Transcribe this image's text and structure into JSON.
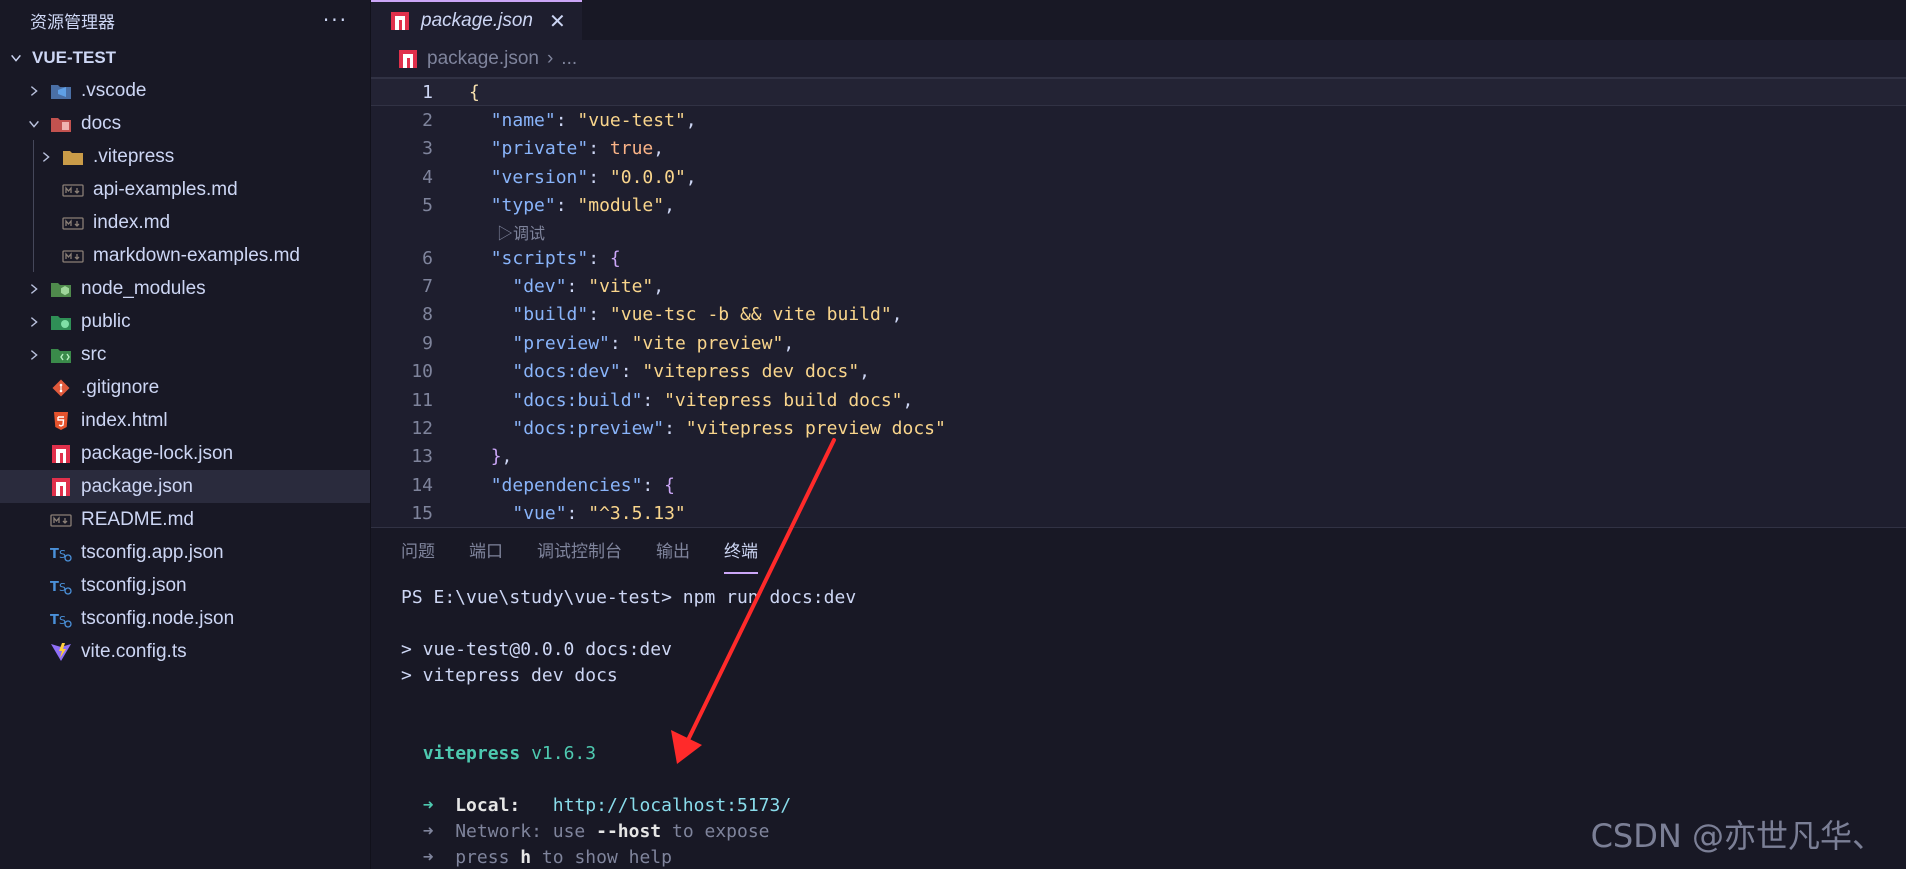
{
  "sidebar": {
    "title": "资源管理器",
    "more_label": "···",
    "project": "VUE-TEST",
    "items": [
      {
        "label": ".vscode",
        "icon": "vscode-folder-icon",
        "chevron": "right",
        "depth": 0
      },
      {
        "label": "docs",
        "icon": "docs-folder-icon",
        "chevron": "down",
        "depth": 0
      },
      {
        "label": ".vitepress",
        "icon": "folder-icon",
        "chevron": "right",
        "depth": 1
      },
      {
        "label": "api-examples.md",
        "icon": "markdown-icon",
        "chevron": "none",
        "depth": 1
      },
      {
        "label": "index.md",
        "icon": "markdown-icon",
        "chevron": "none",
        "depth": 1
      },
      {
        "label": "markdown-examples.md",
        "icon": "markdown-icon",
        "chevron": "none",
        "depth": 1
      },
      {
        "label": "node_modules",
        "icon": "node-folder-icon",
        "chevron": "right",
        "depth": 0
      },
      {
        "label": "public",
        "icon": "public-folder-icon",
        "chevron": "right",
        "depth": 0
      },
      {
        "label": "src",
        "icon": "src-folder-icon",
        "chevron": "right",
        "depth": 0
      },
      {
        "label": ".gitignore",
        "icon": "git-icon",
        "chevron": "none",
        "depth": 0
      },
      {
        "label": "index.html",
        "icon": "html5-icon",
        "chevron": "none",
        "depth": 0
      },
      {
        "label": "package-lock.json",
        "icon": "npm-icon",
        "chevron": "none",
        "depth": 0
      },
      {
        "label": "package.json",
        "icon": "npm-icon",
        "chevron": "none",
        "depth": 0,
        "selected": true
      },
      {
        "label": "README.md",
        "icon": "markdown-icon",
        "chevron": "none",
        "depth": 0
      },
      {
        "label": "tsconfig.app.json",
        "icon": "tsconfig-icon",
        "chevron": "none",
        "depth": 0
      },
      {
        "label": "tsconfig.json",
        "icon": "tsconfig-icon",
        "chevron": "none",
        "depth": 0
      },
      {
        "label": "tsconfig.node.json",
        "icon": "tsconfig-icon",
        "chevron": "none",
        "depth": 0
      },
      {
        "label": "vite.config.ts",
        "icon": "vite-icon",
        "chevron": "none",
        "depth": 0
      }
    ]
  },
  "editor": {
    "tab_label": "package.json",
    "tab_close": "✕",
    "breadcrumb_file": "package.json",
    "breadcrumb_sep": "›",
    "breadcrumb_more": "...",
    "codelens": "▷调试",
    "lines": [
      {
        "num": "1",
        "tokens": [
          [
            "t-brace",
            "{"
          ]
        ]
      },
      {
        "num": "2",
        "tokens": [
          [
            "t-punc",
            "  "
          ],
          [
            "t-key",
            "\"name\""
          ],
          [
            "t-punc",
            ": "
          ],
          [
            "t-str",
            "\"vue-test\""
          ],
          [
            "t-punc",
            ","
          ]
        ]
      },
      {
        "num": "3",
        "tokens": [
          [
            "t-punc",
            "  "
          ],
          [
            "t-key",
            "\"private\""
          ],
          [
            "t-punc",
            ": "
          ],
          [
            "t-bool",
            "true"
          ],
          [
            "t-punc",
            ","
          ]
        ]
      },
      {
        "num": "4",
        "tokens": [
          [
            "t-punc",
            "  "
          ],
          [
            "t-key",
            "\"version\""
          ],
          [
            "t-punc",
            ": "
          ],
          [
            "t-str",
            "\"0.0.0\""
          ],
          [
            "t-punc",
            ","
          ]
        ]
      },
      {
        "num": "5",
        "tokens": [
          [
            "t-punc",
            "  "
          ],
          [
            "t-key",
            "\"type\""
          ],
          [
            "t-punc",
            ": "
          ],
          [
            "t-str",
            "\"module\""
          ],
          [
            "t-punc",
            ","
          ]
        ]
      },
      {
        "num": "6",
        "tokens": [
          [
            "t-punc",
            "  "
          ],
          [
            "t-key",
            "\"scripts\""
          ],
          [
            "t-punc",
            ": "
          ],
          [
            "t-brace2",
            "{"
          ]
        ]
      },
      {
        "num": "7",
        "tokens": [
          [
            "t-punc",
            "    "
          ],
          [
            "t-key",
            "\"dev\""
          ],
          [
            "t-punc",
            ": "
          ],
          [
            "t-str",
            "\"vite\""
          ],
          [
            "t-punc",
            ","
          ]
        ]
      },
      {
        "num": "8",
        "tokens": [
          [
            "t-punc",
            "    "
          ],
          [
            "t-key",
            "\"build\""
          ],
          [
            "t-punc",
            ": "
          ],
          [
            "t-str",
            "\"vue-tsc -b && vite build\""
          ],
          [
            "t-punc",
            ","
          ]
        ]
      },
      {
        "num": "9",
        "tokens": [
          [
            "t-punc",
            "    "
          ],
          [
            "t-key",
            "\"preview\""
          ],
          [
            "t-punc",
            ": "
          ],
          [
            "t-str",
            "\"vite preview\""
          ],
          [
            "t-punc",
            ","
          ]
        ]
      },
      {
        "num": "10",
        "tokens": [
          [
            "t-punc",
            "    "
          ],
          [
            "t-key",
            "\"docs:dev\""
          ],
          [
            "t-punc",
            ": "
          ],
          [
            "t-str",
            "\"vitepress dev docs\""
          ],
          [
            "t-punc",
            ","
          ]
        ]
      },
      {
        "num": "11",
        "tokens": [
          [
            "t-punc",
            "    "
          ],
          [
            "t-key",
            "\"docs:build\""
          ],
          [
            "t-punc",
            ": "
          ],
          [
            "t-str",
            "\"vitepress build docs\""
          ],
          [
            "t-punc",
            ","
          ]
        ]
      },
      {
        "num": "12",
        "tokens": [
          [
            "t-punc",
            "    "
          ],
          [
            "t-key",
            "\"docs:preview\""
          ],
          [
            "t-punc",
            ": "
          ],
          [
            "t-str",
            "\"vitepress preview docs\""
          ]
        ]
      },
      {
        "num": "13",
        "tokens": [
          [
            "t-punc",
            "  "
          ],
          [
            "t-brace2",
            "}"
          ],
          [
            "t-punc",
            ","
          ]
        ]
      },
      {
        "num": "14",
        "tokens": [
          [
            "t-punc",
            "  "
          ],
          [
            "t-key",
            "\"dependencies\""
          ],
          [
            "t-punc",
            ": "
          ],
          [
            "t-brace2",
            "{"
          ]
        ]
      },
      {
        "num": "15",
        "tokens": [
          [
            "t-punc",
            "    "
          ],
          [
            "t-key",
            "\"vue\""
          ],
          [
            "t-punc",
            ": "
          ],
          [
            "t-str",
            "\"^3.5.13\""
          ]
        ]
      }
    ]
  },
  "panel": {
    "tabs": [
      {
        "label": "问题",
        "active": false
      },
      {
        "label": "端口",
        "active": false
      },
      {
        "label": "调试控制台",
        "active": false
      },
      {
        "label": "输出",
        "active": false
      },
      {
        "label": "终端",
        "active": true
      }
    ]
  },
  "terminal": {
    "prompt": "PS E:\\vue\\study\\vue-test> ",
    "command": "npm run docs:dev",
    "out1": "> vue-test@0.0.0 docs:dev",
    "out2": "> vitepress dev docs",
    "vp_name": "vitepress",
    "vp_version": " v1.6.3",
    "arrow": "➜",
    "local_label": "Local:",
    "local_url": "http://localhost:5173/",
    "network_label": "Network",
    "network_pre": ": use ",
    "network_flag": "--host",
    "network_post": " to expose",
    "help_pre": "press ",
    "help_key": "h",
    "help_post": " to show help"
  },
  "watermark": "CSDN @亦世凡华、",
  "colors": {
    "accent": "#cba6f7",
    "annotation_arrow": "#ff2a2a"
  }
}
